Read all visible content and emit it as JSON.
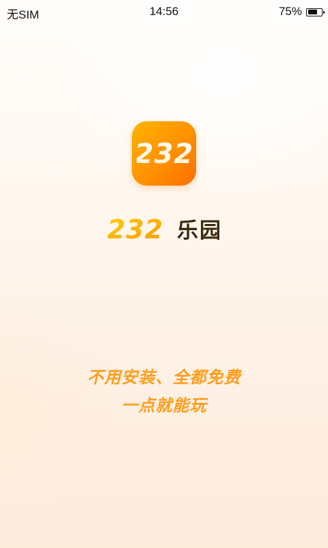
{
  "status_bar": {
    "carrier": "无SIM",
    "time": "14:56",
    "battery_percent": "75%",
    "battery_level": 0.75,
    "battery_icon": "battery-icon"
  },
  "app": {
    "icon_text": "232",
    "logo_text": "232",
    "name": "乐园",
    "brand_colors": {
      "orange_start": "#ffb300",
      "orange_end": "#ff6d00",
      "name_color": "#3a2a10"
    }
  },
  "slogan": {
    "line1": "不用安装、全都免费",
    "line2": "一点就能玩",
    "color": "#ff9d1c"
  }
}
